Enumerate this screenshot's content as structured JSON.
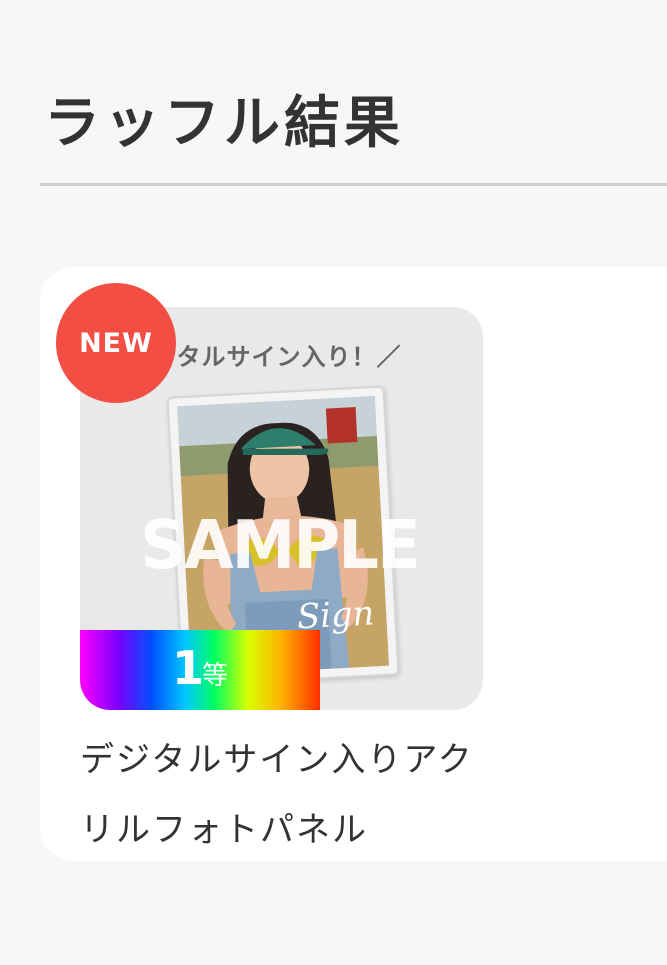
{
  "page": {
    "title": "ラッフル結果"
  },
  "result": {
    "badge": "NEW",
    "thumbnail_caption": "ジタルサイン入り！／",
    "watermark": "SAMPLE",
    "signature_text": "Sign",
    "rank": {
      "number": "1",
      "unit": "等"
    },
    "item_name": "デジタルサイン入りアクリルフォトパネル"
  },
  "colors": {
    "badge": "#f24e43",
    "card_background": "#ffffff",
    "page_background": "#f7f7f7",
    "divider": "#cfcfcf"
  }
}
